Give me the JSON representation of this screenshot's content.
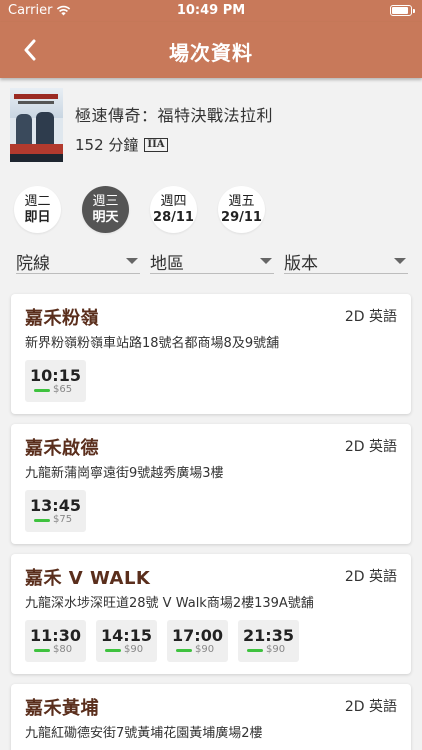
{
  "status": {
    "carrier": "Carrier",
    "time": "10:49 PM"
  },
  "nav": {
    "title": "場次資料"
  },
  "movie": {
    "name": "極速傳奇：福特決戰法拉利",
    "duration": "152 分鐘",
    "rating": "IIA"
  },
  "dates": [
    {
      "weekday": "週二",
      "day": "即日",
      "active": false
    },
    {
      "weekday": "週三",
      "day": "明天",
      "active": true
    },
    {
      "weekday": "週四",
      "day": "28/11",
      "active": false
    },
    {
      "weekday": "週五",
      "day": "29/11",
      "active": false
    }
  ],
  "filters": {
    "chain": "院線",
    "region": "地區",
    "version": "版本"
  },
  "colors": {
    "header": "#c8795a",
    "cinema_name": "#5a2e1c",
    "availability": "#3fc23f"
  },
  "cinemas": [
    {
      "name": "嘉禾粉嶺",
      "format": "2D 英語",
      "address": "新界粉嶺粉嶺車站路18號名都商場8及9號舖",
      "showtimes": [
        {
          "time": "10:15",
          "price": "$65"
        }
      ]
    },
    {
      "name": "嘉禾啟德",
      "format": "2D 英語",
      "address": "九龍新蒲崗寧遠街9號越秀廣場3樓",
      "showtimes": [
        {
          "time": "13:45",
          "price": "$75"
        }
      ]
    },
    {
      "name": "嘉禾 V WALK",
      "format": "2D 英語",
      "address": "九龍深水埗深旺道28號 V Walk商場2樓139A號舖",
      "showtimes": [
        {
          "time": "11:30",
          "price": "$80"
        },
        {
          "time": "14:15",
          "price": "$90"
        },
        {
          "time": "17:00",
          "price": "$90"
        },
        {
          "time": "21:35",
          "price": "$90"
        }
      ]
    },
    {
      "name": "嘉禾黃埔",
      "format": "2D 英語",
      "address": "九龍紅磡德安街7號黃埔花園黃埔廣場2樓",
      "showtimes": []
    }
  ]
}
